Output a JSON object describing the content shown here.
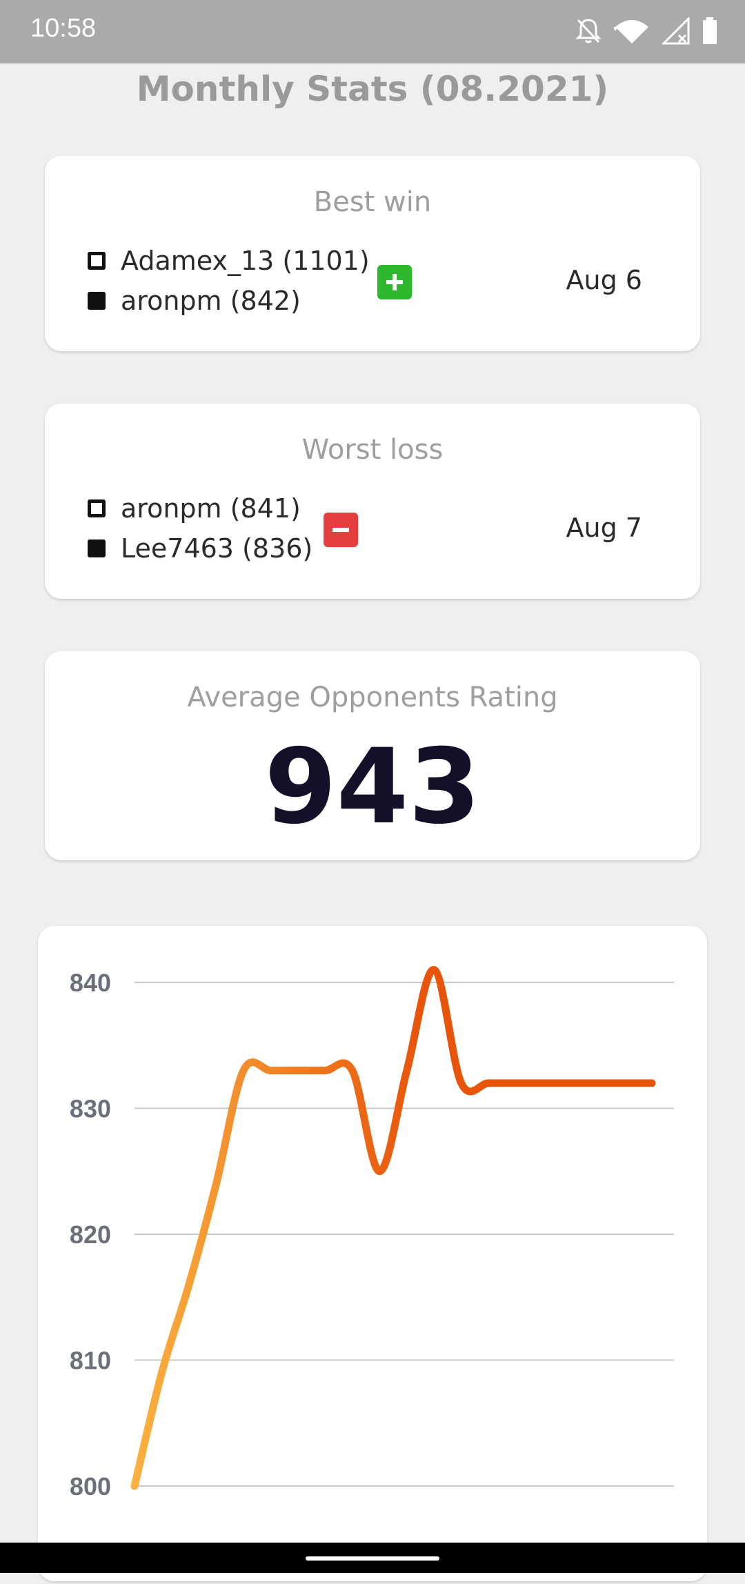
{
  "status_bar": {
    "time": "10:58",
    "icons": [
      "bell-off-icon",
      "wifi-icon",
      "signal-icon",
      "battery-icon"
    ]
  },
  "page": {
    "title": "Monthly Stats (08.2021)"
  },
  "best_win": {
    "title": "Best win",
    "white_player": "Adamex_13 (1101)",
    "black_player": "aronpm (842)",
    "result_icon": "plus-icon",
    "result_color": "#2eb82e",
    "date": "Aug 6"
  },
  "worst_loss": {
    "title": "Worst loss",
    "white_player": "aronpm (841)",
    "black_player": "Lee7463 (836)",
    "result_icon": "minus-icon",
    "result_color": "#e53e3e",
    "date": "Aug 7"
  },
  "average_opponents": {
    "title": "Average Opponents Rating",
    "value": "943"
  },
  "chart_data": {
    "type": "line",
    "title": "",
    "xlabel": "",
    "ylabel": "",
    "ylim": [
      800,
      840
    ],
    "yticks": [
      "840",
      "830",
      "820",
      "810",
      "800"
    ],
    "grid": true,
    "color_start": "#fbb040",
    "color_end": "#e8550a",
    "series": [
      {
        "values": [
          800,
          809,
          816,
          824,
          833,
          833,
          833,
          833,
          833,
          825,
          833,
          841,
          832,
          832,
          832,
          832,
          832,
          832,
          832,
          832
        ]
      }
    ]
  }
}
